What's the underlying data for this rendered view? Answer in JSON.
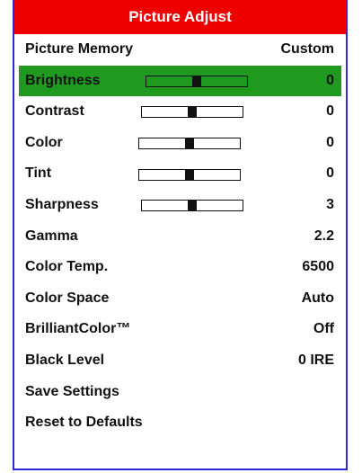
{
  "menu": {
    "title": "Picture Adjust",
    "items": [
      {
        "label": "Picture Memory",
        "value": "Custom"
      },
      {
        "label": "Brightness",
        "value": "0",
        "slider": {
          "level": 0.5
        }
      },
      {
        "label": "Contrast",
        "value": "0",
        "slider": {
          "level": 0.5
        }
      },
      {
        "label": "Color",
        "value": "0",
        "slider": {
          "level": 0.5
        }
      },
      {
        "label": "Tint",
        "value": "0",
        "slider": {
          "level": 0.5
        }
      },
      {
        "label": "Sharpness",
        "value": "3",
        "slider": {
          "level": 0.5
        }
      },
      {
        "label": "Gamma",
        "value": "2.2"
      },
      {
        "label": "Color Temp.",
        "value": "6500"
      },
      {
        "label": "Color Space",
        "value": "Auto"
      },
      {
        "label": "BrilliantColor™",
        "value": "Off"
      },
      {
        "label": "Black Level",
        "value": "0 IRE"
      },
      {
        "label": "Save Settings",
        "value": ""
      },
      {
        "label": "Reset to Defaults",
        "value": ""
      }
    ],
    "selected_label": "Brightness"
  },
  "colors": {
    "title_bar": "#ee0000",
    "selection": "#1f9a1f",
    "border": "#2a2ad8",
    "text": "#111111"
  }
}
